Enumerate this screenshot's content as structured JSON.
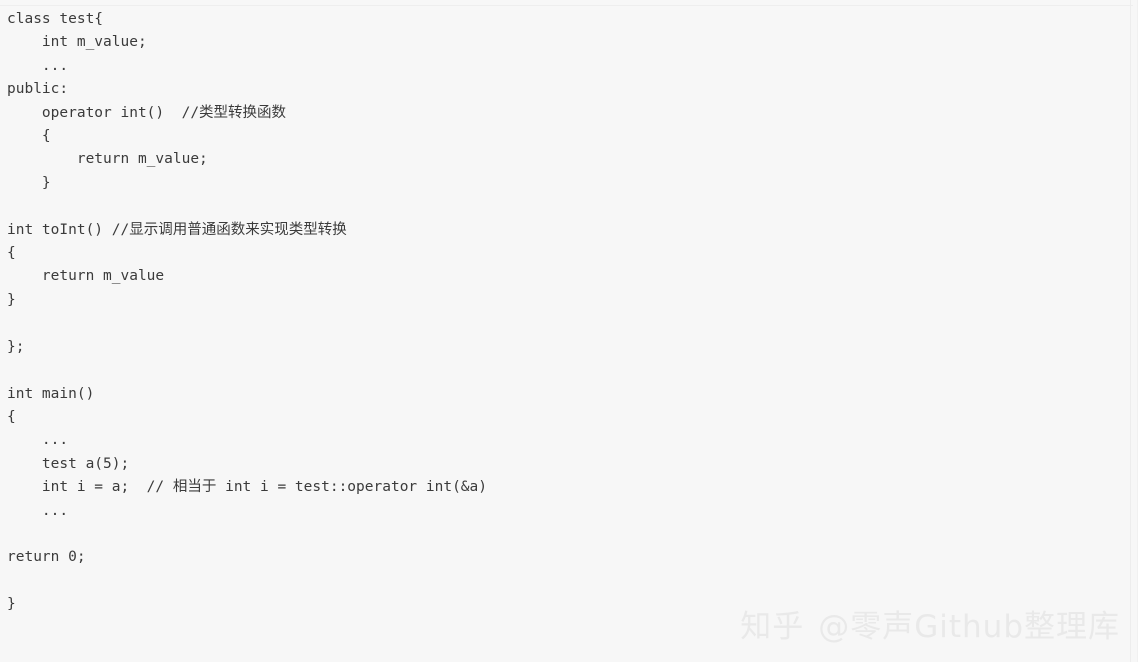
{
  "page": {
    "background_color": "#f7f7f7",
    "text_color": "#3b3b3b"
  },
  "code": {
    "language": "cpp",
    "lines": [
      "class test{",
      "    int m_value;",
      "    ...",
      "public:",
      "    operator int()  //类型转换函数",
      "    {",
      "        return m_value;",
      "    }",
      "",
      "int toInt() //显示调用普通函数来实现类型转换",
      "{",
      "    return m_value",
      "}",
      "",
      "};",
      "",
      "int main()",
      "{",
      "    ...",
      "    test a(5);",
      "    int i = a;  // 相当于 int i = test::operator int(&a)",
      "    ...",
      "",
      "return 0;",
      "",
      "}"
    ]
  },
  "watermark": {
    "site": "知乎",
    "author": "@零声Github整理库",
    "color": "#e9e9e9"
  }
}
